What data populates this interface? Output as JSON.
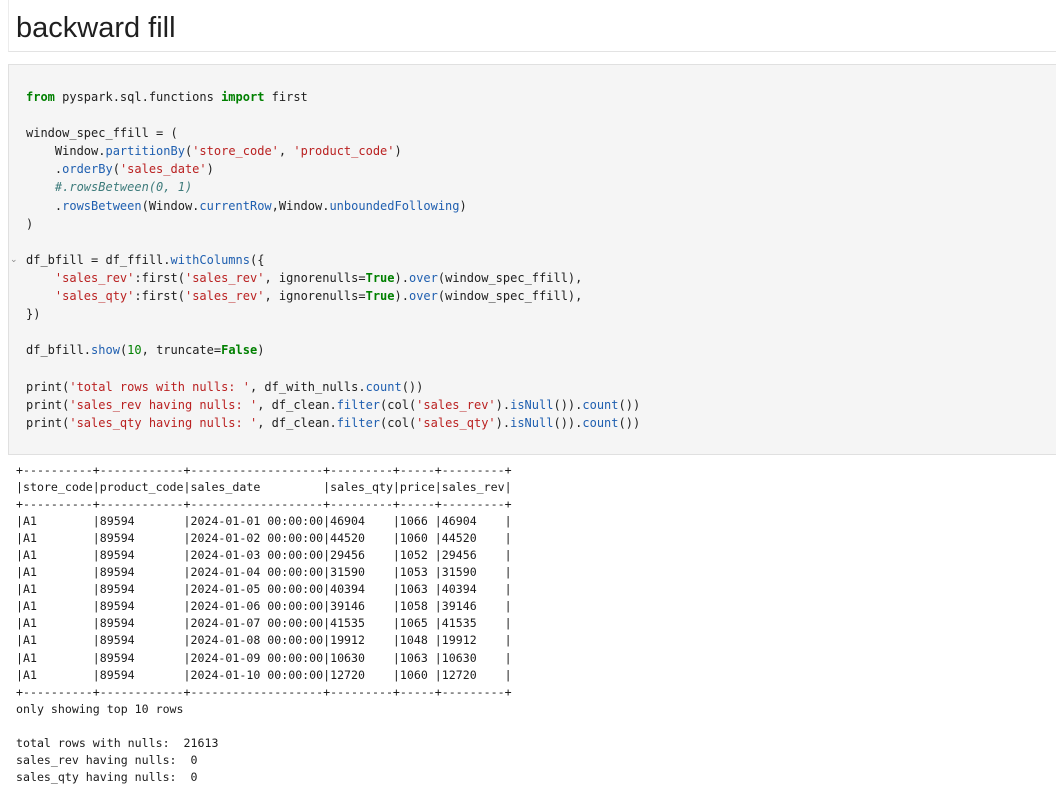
{
  "markdown": {
    "heading": "backward fill"
  },
  "code": {
    "lines": [
      [
        {
          "t": "from",
          "c": "kw"
        },
        {
          "t": " pyspark.sql.functions "
        },
        {
          "t": "import",
          "c": "kw"
        },
        {
          "t": " first"
        }
      ],
      [],
      [
        {
          "t": "window_spec_ffill = ("
        }
      ],
      [
        {
          "t": "    Window."
        },
        {
          "t": "partitionBy",
          "c": "fn"
        },
        {
          "t": "("
        },
        {
          "t": "'store_code'",
          "c": "str"
        },
        {
          "t": ", "
        },
        {
          "t": "'product_code'",
          "c": "str"
        },
        {
          "t": ")"
        }
      ],
      [
        {
          "t": "    ."
        },
        {
          "t": "orderBy",
          "c": "fn"
        },
        {
          "t": "("
        },
        {
          "t": "'sales_date'",
          "c": "str"
        },
        {
          "t": ")"
        }
      ],
      [
        {
          "t": "    #.rowsBetween(0, 1)",
          "c": "cm"
        }
      ],
      [
        {
          "t": "    ."
        },
        {
          "t": "rowsBetween",
          "c": "fn"
        },
        {
          "t": "(Window."
        },
        {
          "t": "currentRow",
          "c": "fn"
        },
        {
          "t": ",Window."
        },
        {
          "t": "unboundedFollowing",
          "c": "fn"
        },
        {
          "t": ")"
        }
      ],
      [
        {
          "t": ")"
        }
      ],
      [],
      [
        {
          "t": "df_bfill = df_ffill."
        },
        {
          "t": "withColumns",
          "c": "fn"
        },
        {
          "t": "({"
        }
      ],
      [
        {
          "t": "    "
        },
        {
          "t": "'sales_rev'",
          "c": "str"
        },
        {
          "t": ":first("
        },
        {
          "t": "'sales_rev'",
          "c": "str"
        },
        {
          "t": ", ignorenulls="
        },
        {
          "t": "True",
          "c": "kw"
        },
        {
          "t": ")."
        },
        {
          "t": "over",
          "c": "fn"
        },
        {
          "t": "(window_spec_ffill),"
        }
      ],
      [
        {
          "t": "    "
        },
        {
          "t": "'sales_qty'",
          "c": "str"
        },
        {
          "t": ":first("
        },
        {
          "t": "'sales_rev'",
          "c": "str"
        },
        {
          "t": ", ignorenulls="
        },
        {
          "t": "True",
          "c": "kw"
        },
        {
          "t": ")."
        },
        {
          "t": "over",
          "c": "fn"
        },
        {
          "t": "(window_spec_ffill),"
        }
      ],
      [
        {
          "t": "})"
        }
      ],
      [],
      [
        {
          "t": "df_bfill."
        },
        {
          "t": "show",
          "c": "fn"
        },
        {
          "t": "("
        },
        {
          "t": "10",
          "c": "num"
        },
        {
          "t": ", truncate="
        },
        {
          "t": "False",
          "c": "kw"
        },
        {
          "t": ")"
        }
      ],
      [],
      [
        {
          "t": "print("
        },
        {
          "t": "'total rows with nulls: '",
          "c": "str"
        },
        {
          "t": ", df_with_nulls."
        },
        {
          "t": "count",
          "c": "fn"
        },
        {
          "t": "())"
        }
      ],
      [
        {
          "t": "print("
        },
        {
          "t": "'sales_rev having nulls: '",
          "c": "str"
        },
        {
          "t": ", df_clean."
        },
        {
          "t": "filter",
          "c": "fn"
        },
        {
          "t": "(col("
        },
        {
          "t": "'sales_rev'",
          "c": "str"
        },
        {
          "t": ")."
        },
        {
          "t": "isNull",
          "c": "fn"
        },
        {
          "t": "())."
        },
        {
          "t": "count",
          "c": "fn"
        },
        {
          "t": "())"
        }
      ],
      [
        {
          "t": "print("
        },
        {
          "t": "'sales_qty having nulls: '",
          "c": "str"
        },
        {
          "t": ", df_clean."
        },
        {
          "t": "filter",
          "c": "fn"
        },
        {
          "t": "(col("
        },
        {
          "t": "'sales_qty'",
          "c": "str"
        },
        {
          "t": ")."
        },
        {
          "t": "isNull",
          "c": "fn"
        },
        {
          "t": "())."
        },
        {
          "t": "count",
          "c": "fn"
        },
        {
          "t": "())"
        }
      ]
    ]
  },
  "output": {
    "table": {
      "columns": [
        "store_code",
        "product_code",
        "sales_date",
        "sales_qty",
        "price",
        "sales_rev"
      ],
      "rows": [
        [
          "A1",
          "89594",
          "2024-01-01 00:00:00",
          "46904",
          "1066",
          "46904"
        ],
        [
          "A1",
          "89594",
          "2024-01-02 00:00:00",
          "44520",
          "1060",
          "44520"
        ],
        [
          "A1",
          "89594",
          "2024-01-03 00:00:00",
          "29456",
          "1052",
          "29456"
        ],
        [
          "A1",
          "89594",
          "2024-01-04 00:00:00",
          "31590",
          "1053",
          "31590"
        ],
        [
          "A1",
          "89594",
          "2024-01-05 00:00:00",
          "40394",
          "1063",
          "40394"
        ],
        [
          "A1",
          "89594",
          "2024-01-06 00:00:00",
          "39146",
          "1058",
          "39146"
        ],
        [
          "A1",
          "89594",
          "2024-01-07 00:00:00",
          "41535",
          "1065",
          "41535"
        ],
        [
          "A1",
          "89594",
          "2024-01-08 00:00:00",
          "19912",
          "1048",
          "19912"
        ],
        [
          "A1",
          "89594",
          "2024-01-09 00:00:00",
          "10630",
          "1063",
          "10630"
        ],
        [
          "A1",
          "89594",
          "2024-01-10 00:00:00",
          "12720",
          "1060",
          "12720"
        ]
      ]
    },
    "footer": "only showing top 10 rows",
    "summary": [
      "total rows with nulls:  21613",
      "sales_rev having nulls:  0",
      "sales_qty having nulls:  0"
    ]
  }
}
